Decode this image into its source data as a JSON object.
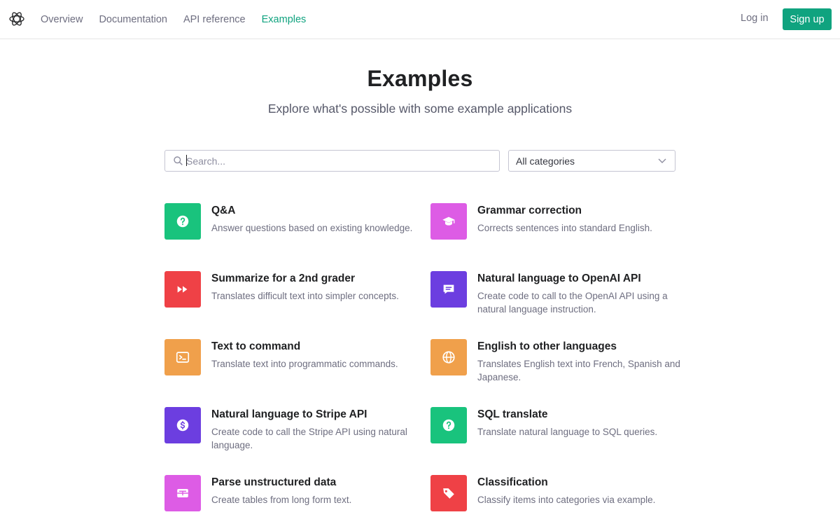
{
  "nav": {
    "items": [
      {
        "label": "Overview"
      },
      {
        "label": "Documentation"
      },
      {
        "label": "API reference"
      },
      {
        "label": "Examples"
      }
    ],
    "login": "Log in",
    "signup": "Sign up",
    "accent": "#10a37f"
  },
  "header": {
    "title": "Examples",
    "subtitle": "Explore what's possible with some example applications"
  },
  "search": {
    "placeholder": "Search...",
    "value": ""
  },
  "filter": {
    "selected": "All categories"
  },
  "examples": [
    {
      "title": "Q&A",
      "desc": "Answer questions based on existing knowledge.",
      "icon": "question-icon",
      "color": "#19c37d"
    },
    {
      "title": "Grammar correction",
      "desc": "Corrects sentences into standard English.",
      "icon": "graduation-cap-icon",
      "color": "#dd5ce5"
    },
    {
      "title": "Summarize for a 2nd grader",
      "desc": "Translates difficult text into simpler concepts.",
      "icon": "fast-forward-icon",
      "color": "#ef4146"
    },
    {
      "title": "Natural language to OpenAI API",
      "desc": "Create code to call to the OpenAI API using a natural language instruction.",
      "icon": "chat-bubble-icon",
      "color": "#6c3ee0"
    },
    {
      "title": "Text to command",
      "desc": "Translate text into programmatic commands.",
      "icon": "terminal-icon",
      "color": "#f0a04b"
    },
    {
      "title": "English to other languages",
      "desc": "Translates English text into French, Spanish and Japanese.",
      "icon": "globe-icon",
      "color": "#f0a04b"
    },
    {
      "title": "Natural language to Stripe API",
      "desc": "Create code to call the Stripe API using natural language.",
      "icon": "dollar-icon",
      "color": "#6c3ee0"
    },
    {
      "title": "SQL translate",
      "desc": "Translate natural language to SQL queries.",
      "icon": "question-icon",
      "color": "#19c37d"
    },
    {
      "title": "Parse unstructured data",
      "desc": "Create tables from long form text.",
      "icon": "table-icon",
      "color": "#dd5ce5"
    },
    {
      "title": "Classification",
      "desc": "Classify items into categories via example.",
      "icon": "tag-icon",
      "color": "#ef4146"
    }
  ]
}
